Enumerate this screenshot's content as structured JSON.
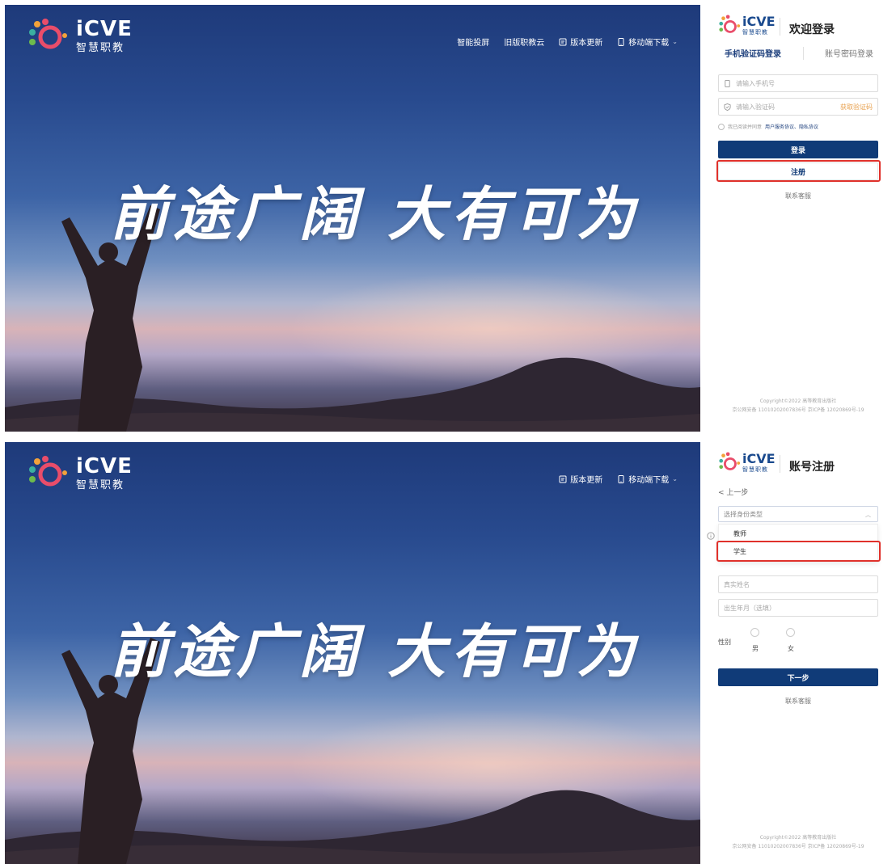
{
  "brand": {
    "name": "iCVE",
    "sub": "智慧职教"
  },
  "hero": {
    "slogan": "前途广阔 大有可为"
  },
  "top_panel": {
    "nav": [
      {
        "label": "智能投屏",
        "icon": ""
      },
      {
        "label": "旧版职教云",
        "icon": ""
      },
      {
        "label": "版本更新",
        "icon": "update-icon"
      },
      {
        "label": "移动端下载",
        "icon": "mobile-icon"
      }
    ],
    "login": {
      "heading": "欢迎登录",
      "tabs": [
        "手机验证码登录",
        "账号密码登录"
      ],
      "phone_placeholder": "请输入手机号",
      "code_placeholder": "请输入验证码",
      "get_code": "获取验证码",
      "agree_prefix": "我已阅读并同意",
      "agree_links": "用户服务协议、隐私协议",
      "login_button": "登录",
      "register_button": "注册",
      "service": "联系客服"
    }
  },
  "bottom_panel": {
    "nav": [
      {
        "label": "版本更新",
        "icon": "update-icon"
      },
      {
        "label": "移动端下载",
        "icon": "mobile-icon"
      }
    ],
    "register": {
      "heading": "账号注册",
      "back": "< 上一步",
      "select_placeholder": "选择身份类型",
      "options": [
        "教师",
        "学生"
      ],
      "name_placeholder": "真实姓名",
      "birth_placeholder": "出生年月（选填）",
      "gender_label": "性别",
      "male": "男",
      "female": "女",
      "next_button": "下一步",
      "service": "联系客服"
    }
  },
  "footer": {
    "line1": "Copyright©2022 高等教育出版社",
    "line2": "京公网安备 11010202007836号 京ICP备 12020869号-19"
  },
  "colors": {
    "primary": "#103b78",
    "highlight": "#e0312b",
    "accent_orange": "#e8a04d"
  }
}
